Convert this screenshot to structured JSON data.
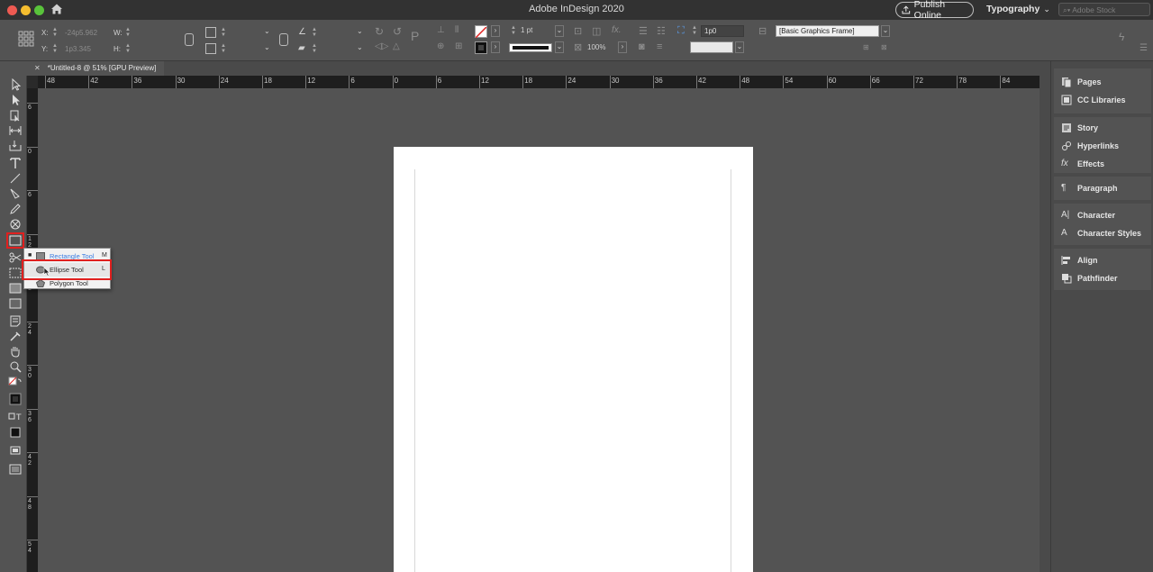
{
  "titlebar": {
    "app_title": "Adobe InDesign 2020",
    "publish_label": "Publish Online",
    "workspace_label": "Typography",
    "stock_search_placeholder": "Adobe Stock"
  },
  "controlbar": {
    "x_label": "X:",
    "x_value": "-24p5.962",
    "y_label": "Y:",
    "y_value": "1p3.345",
    "w_label": "W:",
    "h_label": "H:",
    "stroke_weight": "1 pt",
    "opacity": "100%",
    "frame_style": "[Basic Graphics Frame]",
    "corner_value": "1p0"
  },
  "tabbar": {
    "close_glyph": "✕",
    "doc_tab_label": "*Untitled-8 @ 51% [GPU Preview]"
  },
  "ruler": {
    "top_labels": [
      "48",
      "42",
      "36",
      "30",
      "24",
      "18",
      "12",
      "6",
      "0",
      "6",
      "12",
      "18",
      "24",
      "30",
      "36",
      "42",
      "48",
      "54",
      "60",
      "66",
      "72",
      "78",
      "84"
    ],
    "left_labels": [
      "6",
      "0",
      "6",
      "1 2",
      "1 8",
      "2 4",
      "3 0",
      "3 6",
      "4 2",
      "4 8",
      "5 4"
    ]
  },
  "flyout": {
    "rectangle_label": "Rectangle Tool",
    "rectangle_key": "M",
    "ellipse_label": "Ellipse Tool",
    "ellipse_key": "L",
    "polygon_label": "Polygon Tool",
    "bullet": "■"
  },
  "panels": {
    "pages": "Pages",
    "cc_libraries": "CC Libraries",
    "story": "Story",
    "hyperlinks": "Hyperlinks",
    "effects": "Effects",
    "paragraph": "Paragraph",
    "character": "Character",
    "character_styles": "Character Styles",
    "align": "Align",
    "pathfinder": "Pathfinder"
  },
  "colors": {
    "highlight": "#e0201f",
    "selected_text": "#3a7be0"
  }
}
